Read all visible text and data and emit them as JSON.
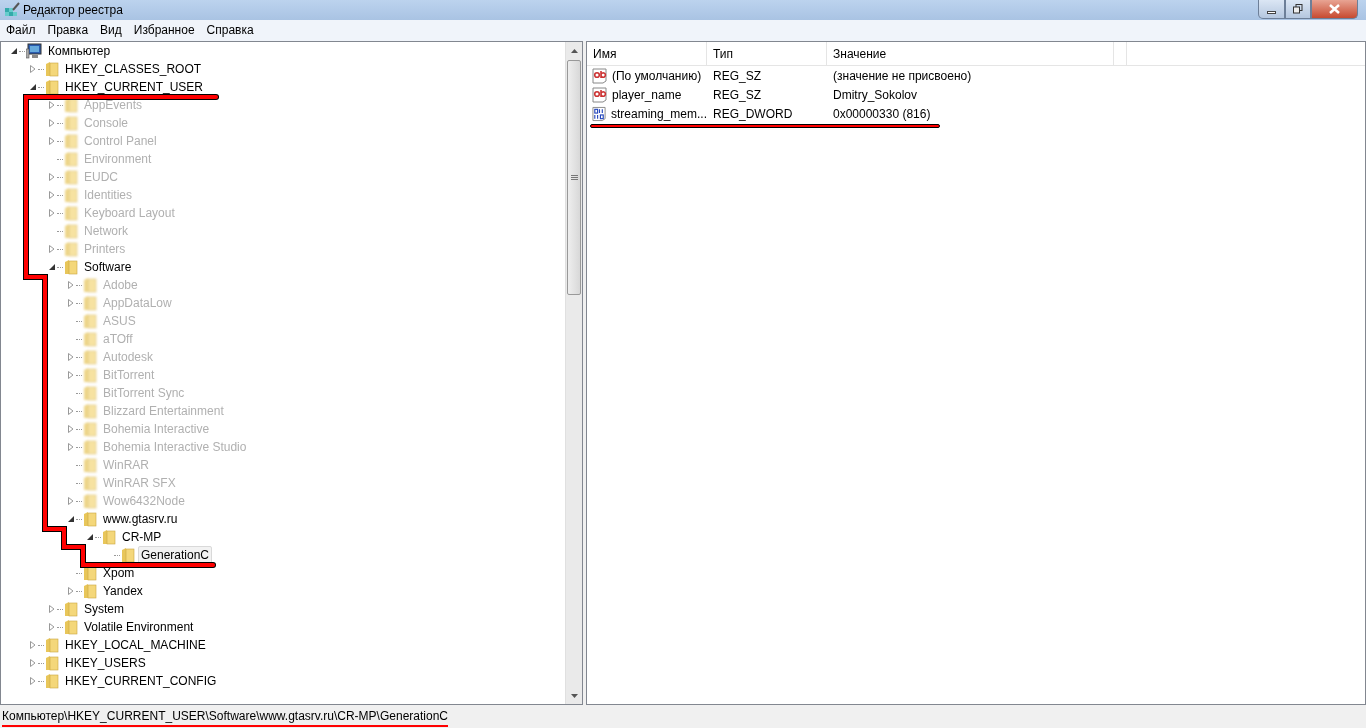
{
  "window": {
    "title": "Редактор реестра"
  },
  "menu": [
    "Файл",
    "Правка",
    "Вид",
    "Избранное",
    "Справка"
  ],
  "tree": [
    {
      "label": "Компьютер",
      "kind": "computer",
      "expanded": true,
      "selected": false,
      "blurred": false,
      "children": [
        {
          "label": "HKEY_CLASSES_ROOT",
          "kind": "folder",
          "expanded": false,
          "selected": false,
          "blurred": false
        },
        {
          "label": "HKEY_CURRENT_USER",
          "kind": "folder",
          "expanded": true,
          "selected": false,
          "blurred": false,
          "marked": true,
          "children": [
            {
              "label": "AppEvents",
              "kind": "folder",
              "expanded": false,
              "selected": false,
              "blurred": true
            },
            {
              "label": "Console",
              "kind": "folder",
              "expanded": false,
              "selected": false,
              "blurred": true
            },
            {
              "label": "Control Panel",
              "kind": "folder",
              "expanded": false,
              "selected": false,
              "blurred": true
            },
            {
              "label": "Environment",
              "kind": "folder",
              "selected": false,
              "blurred": true
            },
            {
              "label": "EUDC",
              "kind": "folder",
              "expanded": false,
              "selected": false,
              "blurred": true
            },
            {
              "label": "Identities",
              "kind": "folder",
              "expanded": false,
              "selected": false,
              "blurred": true
            },
            {
              "label": "Keyboard Layout",
              "kind": "folder",
              "expanded": false,
              "selected": false,
              "blurred": true
            },
            {
              "label": "Network",
              "kind": "folder",
              "selected": false,
              "blurred": true
            },
            {
              "label": "Printers",
              "kind": "folder",
              "expanded": false,
              "selected": false,
              "blurred": true
            },
            {
              "label": "Software",
              "kind": "folder",
              "expanded": true,
              "selected": false,
              "blurred": false,
              "marked": true,
              "children": [
                {
                  "label": "Adobe",
                  "kind": "folder",
                  "expanded": false,
                  "selected": false,
                  "blurred": true
                },
                {
                  "label": "AppDataLow",
                  "kind": "folder",
                  "expanded": false,
                  "selected": false,
                  "blurred": true
                },
                {
                  "label": "ASUS",
                  "kind": "folder",
                  "selected": false,
                  "blurred": true
                },
                {
                  "label": "aTOff",
                  "kind": "folder",
                  "selected": false,
                  "blurred": true
                },
                {
                  "label": "Autodesk",
                  "kind": "folder",
                  "expanded": false,
                  "selected": false,
                  "blurred": true
                },
                {
                  "label": "BitTorrent",
                  "kind": "folder",
                  "expanded": false,
                  "selected": false,
                  "blurred": true
                },
                {
                  "label": "BitTorrent Sync",
                  "kind": "folder",
                  "selected": false,
                  "blurred": true
                },
                {
                  "label": "Blizzard Entertainment",
                  "kind": "folder",
                  "expanded": false,
                  "selected": false,
                  "blurred": true
                },
                {
                  "label": "Bohemia Interactive",
                  "kind": "folder",
                  "expanded": false,
                  "selected": false,
                  "blurred": true
                },
                {
                  "label": "Bohemia Interactive Studio",
                  "kind": "folder",
                  "expanded": false,
                  "selected": false,
                  "blurred": true
                },
                {
                  "label": "WinRAR",
                  "kind": "folder",
                  "selected": false,
                  "blurred": true
                },
                {
                  "label": "WinRAR SFX",
                  "kind": "folder",
                  "selected": false,
                  "blurred": true
                },
                {
                  "label": "Wow6432Node",
                  "kind": "folder",
                  "expanded": false,
                  "selected": false,
                  "blurred": true
                },
                {
                  "label": "www.gtasrv.ru",
                  "kind": "folder",
                  "expanded": true,
                  "selected": false,
                  "blurred": false,
                  "marked": true,
                  "children": [
                    {
                      "label": "CR-MP",
                      "kind": "folder",
                      "expanded": true,
                      "selected": false,
                      "blurred": false,
                      "marked": true,
                      "children": [
                        {
                          "label": "GenerationC",
                          "kind": "folder",
                          "selected": true,
                          "blurred": false,
                          "marked": true
                        }
                      ]
                    }
                  ]
                },
                {
                  "label": "Xpom",
                  "kind": "folder",
                  "selected": false,
                  "blurred": false
                },
                {
                  "label": "Yandex",
                  "kind": "folder",
                  "expanded": false,
                  "selected": false,
                  "blurred": false
                }
              ]
            },
            {
              "label": "System",
              "kind": "folder",
              "expanded": false,
              "selected": false,
              "blurred": false
            },
            {
              "label": "Volatile Environment",
              "kind": "folder",
              "expanded": false,
              "selected": false,
              "blurred": false
            }
          ]
        },
        {
          "label": "HKEY_LOCAL_MACHINE",
          "kind": "folder",
          "expanded": false,
          "selected": false,
          "blurred": false
        },
        {
          "label": "HKEY_USERS",
          "kind": "folder",
          "expanded": false,
          "selected": false,
          "blurred": false
        },
        {
          "label": "HKEY_CURRENT_CONFIG",
          "kind": "folder",
          "expanded": false,
          "selected": false,
          "blurred": false
        }
      ]
    }
  ],
  "values": {
    "columns": [
      "Имя",
      "Тип",
      "Значение"
    ],
    "rows": [
      {
        "name": "(По умолчанию)",
        "type": "REG_SZ",
        "data": "(значение не присвоено)",
        "kind": "string"
      },
      {
        "name": "player_name",
        "type": "REG_SZ",
        "data": "Dmitry_Sokolov",
        "kind": "string"
      },
      {
        "name": "streaming_mem...",
        "type": "REG_DWORD",
        "data": "0x00000330 (816)",
        "kind": "binary",
        "marked": true
      }
    ]
  },
  "status_bar": {
    "text": "Компьютер\\HKEY_CURRENT_USER\\Software\\www.gtasrv.ru\\CR-MP\\GenerationC",
    "marked": true
  }
}
